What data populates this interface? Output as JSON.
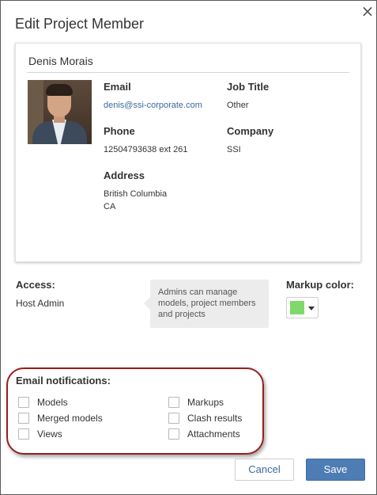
{
  "dialog": {
    "title": "Edit Project Member",
    "close_icon": "close-icon"
  },
  "member": {
    "name": "Denis Morais",
    "avatar": "avatar-photo",
    "email_label": "Email",
    "email_value": "denis@ssi-corporate.com",
    "job_title_label": "Job Title",
    "job_title_value": "Other",
    "phone_label": "Phone",
    "phone_value": "12504793638 ext 261",
    "company_label": "Company",
    "company_value": "SSI",
    "address_label": "Address",
    "address_line1": "British Columbia",
    "address_line2": "CA"
  },
  "access": {
    "label": "Access:",
    "value": "Host Admin",
    "tooltip": "Admins can manage models, project members and projects"
  },
  "markup": {
    "label": "Markup color:",
    "color": "#7ed96a",
    "caret_icon": "caret-down-icon"
  },
  "email_notifications": {
    "label": "Email notifications:",
    "left": [
      {
        "label": "Models",
        "checked": false
      },
      {
        "label": "Merged models",
        "checked": false
      },
      {
        "label": "Views",
        "checked": false
      }
    ],
    "right": [
      {
        "label": "Markups",
        "checked": false
      },
      {
        "label": "Clash results",
        "checked": false
      },
      {
        "label": "Attachments",
        "checked": false
      }
    ]
  },
  "buttons": {
    "cancel": "Cancel",
    "save": "Save"
  },
  "colors": {
    "accent": "#4d7db4",
    "link": "#3a6a9b",
    "highlight_ring": "#9b1c1c"
  }
}
